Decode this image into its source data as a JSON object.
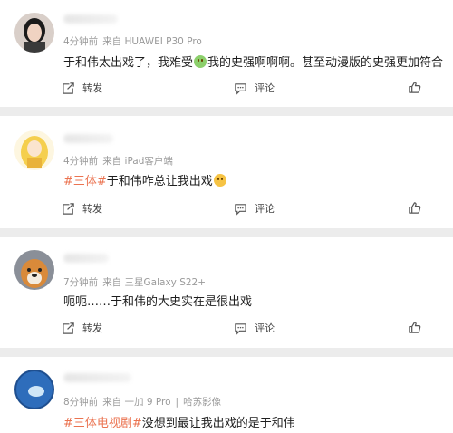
{
  "comments": [
    {
      "meta": [
        "4分钟前",
        "来自 HUAWEI P30 Pro"
      ],
      "text_before": "于和伟太出戏了，我难受",
      "text_after": "我的史强啊啊啊。甚至动漫版的史强更加符合",
      "actions": {
        "repost": "转发",
        "comment": "评论"
      }
    },
    {
      "meta": [
        "4分钟前",
        "来自 iPad客户端"
      ],
      "tag": "#三体#",
      "text": "于和伟咋总让我出戏",
      "actions": {
        "repost": "转发",
        "comment": "评论"
      }
    },
    {
      "meta": [
        "7分钟前",
        "来自 三星Galaxy S22+"
      ],
      "text": "呃呃……于和伟的大史实在是很出戏",
      "actions": {
        "repost": "转发",
        "comment": "评论"
      }
    },
    {
      "meta": [
        "8分钟前",
        "来自 一加 9 Pro",
        "|",
        "哈苏影像"
      ],
      "tag": "#三体电视剧#",
      "text": "没想到最让我出戏的是于和伟"
    }
  ],
  "icons": {
    "repost": "repost-icon",
    "comment": "comment-icon",
    "like": "like-icon"
  },
  "colors": {
    "tag": "#eb7350",
    "meta": "#9a9a9a",
    "background": "#ececec"
  }
}
